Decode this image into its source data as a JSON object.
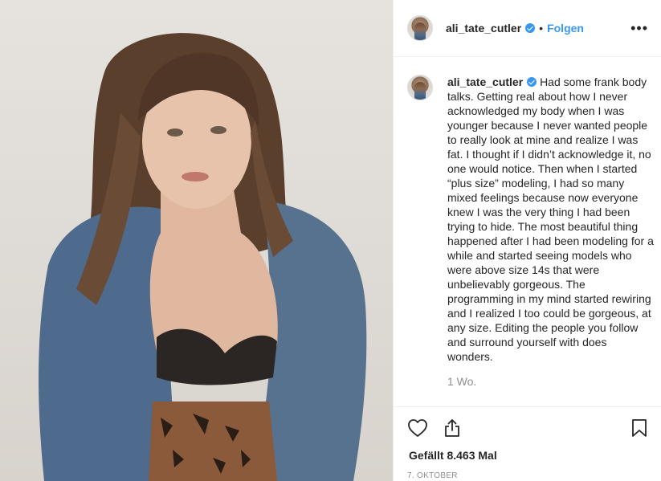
{
  "post": {
    "username": "ali_tate_cutler",
    "follow_label": "Folgen",
    "separator": "•",
    "more_label": "•••",
    "caption": "Had some frank body talks. Getting real about how I never acknowledged my body when I was younger because I never wanted people to really look at mine and realize I was fat. I thought if I didn’t acknowledge it, no one would notice. Then when I started “plus size” modeling, I had so many mixed feelings because now everyone knew I was the very thing I had been trying to hide. The most beautiful thing happened after I had been modeling for a while and started seeing models who were above size 14s that were unbelievably gorgeous. The programming in my mind started rewiring and I realized I too could be gorgeous, at any size. Editing the people you follow and surround yourself with does wonders.",
    "time_ago": "1 Wo.",
    "likes": "Gefällt 8.463 Mal",
    "date": "7. OKTOBER"
  },
  "icons": {
    "like": "heart-icon",
    "share": "share-icon",
    "save": "bookmark-icon",
    "verified": "verified-badge-icon"
  },
  "colors": {
    "accent": "#3897f0",
    "text": "#262626",
    "muted": "#8e8e8e",
    "border": "#efefef"
  }
}
